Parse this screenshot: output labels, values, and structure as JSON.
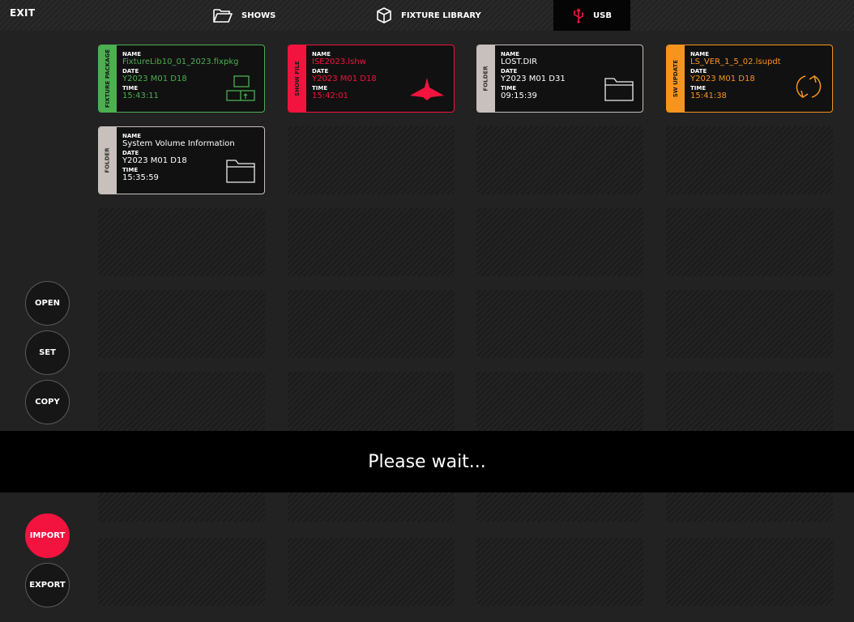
{
  "topbar": {
    "exit_label": "EXIT",
    "tabs": [
      {
        "label": "SHOWS",
        "icon": "folder-icon"
      },
      {
        "label": "FIXTURE LIBRARY",
        "icon": "cube-icon"
      },
      {
        "label": "USB",
        "icon": "usb-icon",
        "active": true
      }
    ]
  },
  "labels": {
    "name": "NAME",
    "date": "DATE",
    "time": "TIME"
  },
  "files": [
    {
      "type": "FIXTURE PACKAGE",
      "name": "FixtureLib10_01_2023.fixpkg",
      "date": "Y2023 M01 D18",
      "time": "15:43:11",
      "color": "#4caf50",
      "icon": "fixture-package-icon"
    },
    {
      "type": "SHOW FILE",
      "name": "ISE2023.lshw",
      "date": "Y2023 M01 D18",
      "time": "15:42:01",
      "color": "#f2133e",
      "icon": "show-file-icon"
    },
    {
      "type": "FOLDER",
      "name": "LOST.DIR",
      "date": "Y2023 M01 D31",
      "time": "09:15:39",
      "color": "#c8c0bc",
      "icon": "folder-icon"
    },
    {
      "type": "SW UPDATE",
      "name": "LS_VER_1_5_02.lsupdt",
      "date": "Y2023 M01 D18",
      "time": "15:41:38",
      "color": "#f7941d",
      "icon": "refresh-icon"
    },
    {
      "type": "FOLDER",
      "name": "System Volume Information",
      "date": "Y2023 M01 D18",
      "time": "15:35:59",
      "color": "#c8c0bc",
      "icon": "folder-icon"
    }
  ],
  "sidebar": {
    "open_label": "OPEN",
    "set_label": "SET",
    "copy_label": "COPY",
    "import_label": "IMPORT",
    "export_label": "EXPORT"
  },
  "overlay": {
    "message": "Please wait..."
  },
  "colors": {
    "accent": "#f2133e",
    "green": "#4caf50",
    "orange": "#f7941d",
    "folder": "#c8c0bc"
  }
}
